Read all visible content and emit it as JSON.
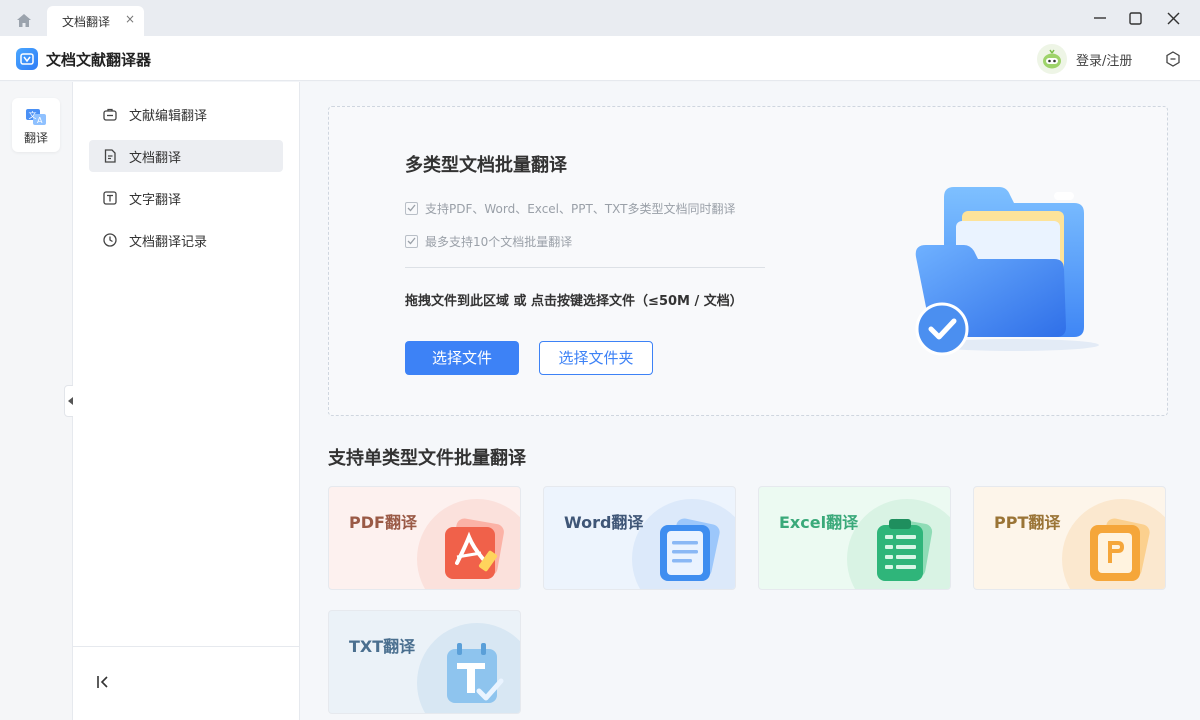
{
  "titlebar": {
    "tab_label": "文档翻译",
    "tab_close": "×"
  },
  "appbar": {
    "title": "文档文献翻译器",
    "login_label": "登录/注册"
  },
  "rail": {
    "items": [
      {
        "label": "翻译",
        "icon": "translate-icon"
      }
    ]
  },
  "sidebar": {
    "items": [
      {
        "label": "文献编辑翻译",
        "icon": "briefcase-icon",
        "active": false
      },
      {
        "label": "文档翻译",
        "icon": "document-icon",
        "active": true
      },
      {
        "label": "文字翻译",
        "icon": "text-icon",
        "active": false
      },
      {
        "label": "文档翻译记录",
        "icon": "clock-icon",
        "active": false
      }
    ]
  },
  "upload": {
    "title": "多类型文档批量翻译",
    "features": [
      "支持PDF、Word、Excel、PPT、TXT多类型文档同时翻译",
      "最多支持10个文档批量翻译"
    ],
    "drop_hint": "拖拽文件到此区域 或 点击按键选择文件（≤50M / 文档）",
    "select_file_label": "选择文件",
    "select_folder_label": "选择文件夹"
  },
  "types_section": {
    "title": "支持单类型文件批量翻译",
    "cards": [
      {
        "label": "PDF翻译",
        "text_color": "#9a5a46",
        "bg": "#fdf1ef",
        "blob": "#fbe1dc",
        "accent": "#f0614a",
        "icon": "pdf-icon"
      },
      {
        "label": "Word翻译",
        "text_color": "#3f5677",
        "bg": "#edf4fd",
        "blob": "#dce9fa",
        "accent": "#3f8ef0",
        "icon": "word-icon"
      },
      {
        "label": "Excel翻译",
        "text_color": "#3aa97a",
        "bg": "#ecfaf2",
        "blob": "#d9f3e4",
        "accent": "#2fb57a",
        "icon": "excel-icon"
      },
      {
        "label": "PPT翻译",
        "text_color": "#9a7436",
        "bg": "#fdf5ea",
        "blob": "#fbe8cf",
        "accent": "#f5a63a",
        "icon": "ppt-icon"
      },
      {
        "label": "TXT翻译",
        "text_color": "#4a6f8f",
        "bg": "#ebf2f8",
        "blob": "#d8e7f3",
        "accent": "#6aaee6",
        "icon": "txt-icon"
      }
    ]
  }
}
